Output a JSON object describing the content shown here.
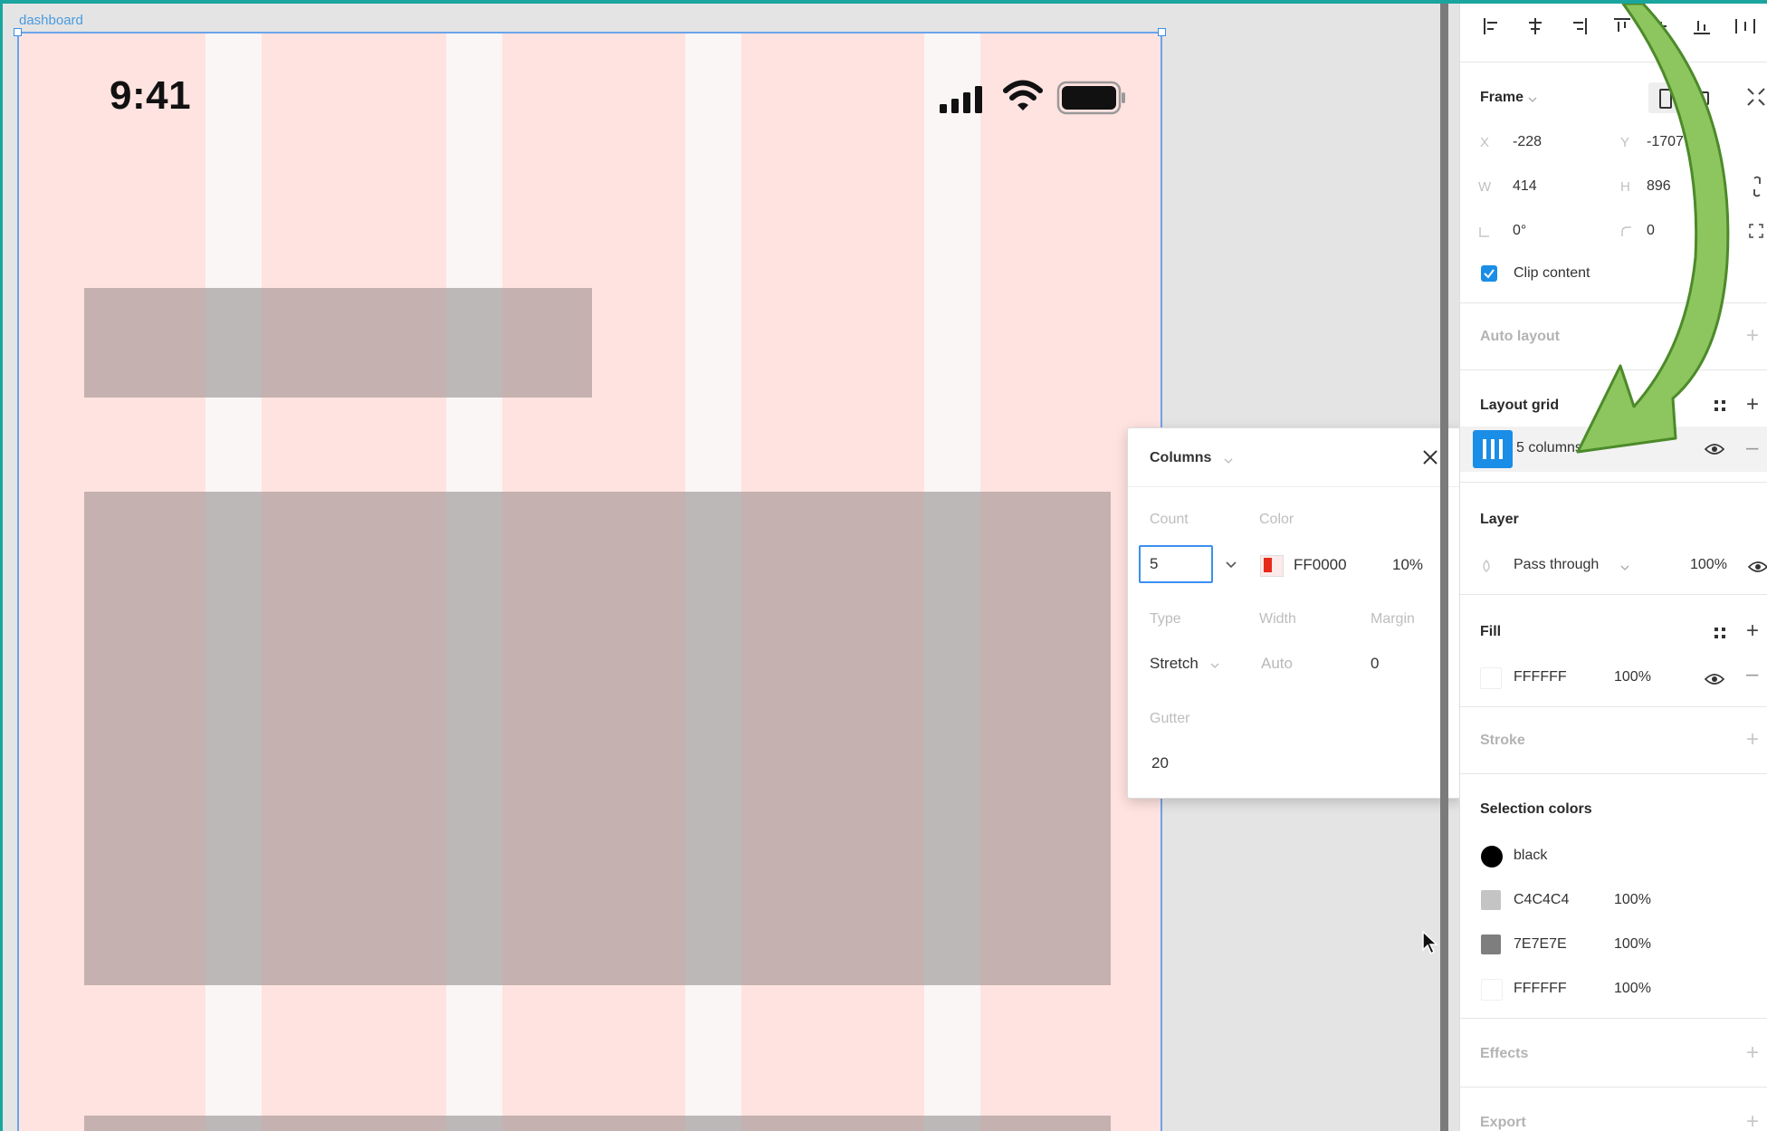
{
  "canvas": {
    "frame_label": "dashboard",
    "status_time": "9:41"
  },
  "toolbar": {
    "align_icons": [
      "align-left-icon",
      "align-hcenter-icon",
      "align-right-icon",
      "align-top-icon",
      "align-vcenter-icon",
      "align-bottom-icon",
      "distribute-icon"
    ]
  },
  "frame_section": {
    "title": "Frame",
    "x_label": "X",
    "x_value": "-228",
    "y_label": "Y",
    "y_value": "-1707",
    "w_label": "W",
    "w_value": "414",
    "h_label": "H",
    "h_value": "896",
    "rotation_value": "0°",
    "radius_value": "0",
    "clip_content_label": "Clip content",
    "clip_content_checked": true
  },
  "auto_layout": {
    "title": "Auto layout"
  },
  "layout_grid": {
    "title": "Layout grid",
    "item_label": "5 columns"
  },
  "layer": {
    "title": "Layer",
    "blend_mode": "Pass through",
    "opacity": "100%"
  },
  "fill": {
    "title": "Fill",
    "hex": "FFFFFF",
    "opacity": "100%"
  },
  "stroke": {
    "title": "Stroke"
  },
  "selection_colors": {
    "title": "Selection colors",
    "items": [
      {
        "name": "black",
        "opacity": "",
        "color": "#000000"
      },
      {
        "name": "C4C4C4",
        "opacity": "100%",
        "color": "#C4C4C4"
      },
      {
        "name": "7E7E7E",
        "opacity": "100%",
        "color": "#7E7E7E"
      },
      {
        "name": "FFFFFF",
        "opacity": "100%",
        "color": "#FFFFFF"
      }
    ]
  },
  "effects": {
    "title": "Effects"
  },
  "export": {
    "title": "Export"
  },
  "popup": {
    "title": "Columns",
    "count_label": "Count",
    "count_value": "5",
    "color_label": "Color",
    "color_hex": "FF0000",
    "color_opacity": "10%",
    "type_label": "Type",
    "type_value": "Stretch",
    "width_label": "Width",
    "width_value": "Auto",
    "margin_label": "Margin",
    "margin_value": "0",
    "gutter_label": "Gutter",
    "gutter_value": "20"
  },
  "colors": {
    "accent": "#3B8FF0",
    "grid_tint": "#FFE3E0",
    "arrow": "#8DC55F"
  }
}
